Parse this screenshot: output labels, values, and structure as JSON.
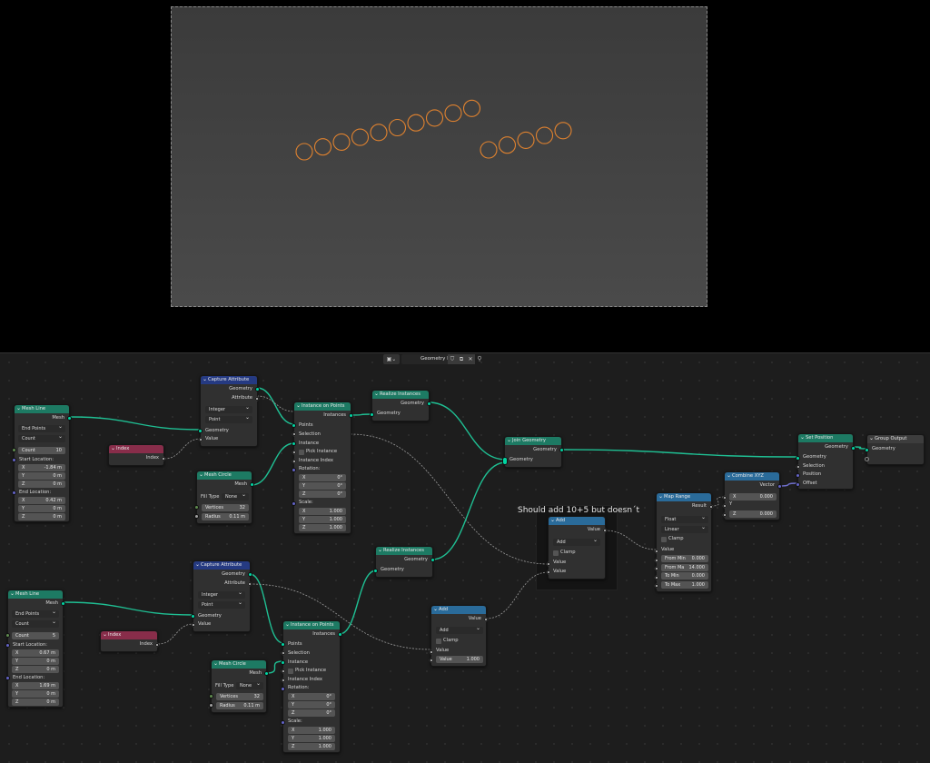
{
  "header": {
    "editor_name": "Geometry Nodes",
    "icon": "node-tree-icon",
    "btn_icons": [
      "shield-icon",
      "copy-icon",
      "close-icon"
    ],
    "pin_icon": "pin-icon"
  },
  "frame_note": "Should add 10+5 but doesn´t",
  "viewport": {
    "row1_circles": 10,
    "row2_circles": 5,
    "circle_color": "#e0822f"
  },
  "nodes": {
    "mesh_line_1": {
      "title": "Mesh Line",
      "out": "Mesh",
      "mode": "End Points",
      "count_mode": "Count",
      "count_k": "Count",
      "count_v": "10",
      "start": "Start Location:",
      "sx": "-1.84 m",
      "sy": "0 m",
      "sz": "0 m",
      "end": "End Location:",
      "ex": "0.42 m",
      "ey": "0 m",
      "ez": "0 m"
    },
    "mesh_line_2": {
      "title": "Mesh Line",
      "out": "Mesh",
      "mode": "End Points",
      "count_mode": "Count",
      "count_k": "Count",
      "count_v": "5",
      "start": "Start Location:",
      "sx": "0.67 m",
      "sy": "0 m",
      "sz": "0 m",
      "end": "End Location:",
      "ex": "1.69 m",
      "ey": "0 m",
      "ez": "0 m"
    },
    "index_1": {
      "title": "Index",
      "out": "Index"
    },
    "index_2": {
      "title": "Index",
      "out": "Index"
    },
    "capture_1": {
      "title": "Capture Attribute",
      "out1": "Geometry",
      "out2": "Attribute",
      "type": "Integer",
      "domain": "Point",
      "in1": "Geometry",
      "in2": "Value"
    },
    "capture_2": {
      "title": "Capture Attribute",
      "out1": "Geometry",
      "out2": "Attribute",
      "type": "Integer",
      "domain": "Point",
      "in1": "Geometry",
      "in2": "Value"
    },
    "circle_1": {
      "title": "Mesh Circle",
      "out": "Mesh",
      "fill_label": "Fill Type",
      "fill": "None",
      "vk": "Vertices",
      "vv": "32",
      "rk": "Radius",
      "rv": "0.11 m"
    },
    "circle_2": {
      "title": "Mesh Circle",
      "out": "Mesh",
      "fill_label": "Fill Type",
      "fill": "None",
      "vk": "Vertices",
      "vv": "32",
      "rk": "Radius",
      "rv": "0.11 m"
    },
    "iop_1": {
      "title": "Instance on Points",
      "out": "Instances",
      "points": "Points",
      "selection": "Selection",
      "instance": "Instance",
      "pick": "Pick Instance",
      "idx": "Instance Index",
      "rot": "Rotation:",
      "rx": "0°",
      "ry": "0°",
      "rz": "0°",
      "scale": "Scale:",
      "scx": "1.000",
      "scy": "1.000",
      "scz": "1.000"
    },
    "iop_2": {
      "title": "Instance on Points",
      "out": "Instances",
      "points": "Points",
      "selection": "Selection",
      "instance": "Instance",
      "pick": "Pick Instance",
      "idx": "Instance Index",
      "rot": "Rotation:",
      "rx": "0°",
      "ry": "0°",
      "rz": "0°",
      "scale": "Scale:",
      "scx": "1.000",
      "scy": "1.000",
      "scz": "1.000"
    },
    "realize_1": {
      "title": "Realize Instances",
      "out": "Geometry",
      "in": "Geometry"
    },
    "realize_2": {
      "title": "Realize Instances",
      "out": "Geometry",
      "in": "Geometry"
    },
    "join": {
      "title": "Join Geometry",
      "out": "Geometry",
      "in": "Geometry"
    },
    "add_frame": {
      "title": "Add",
      "out": "Value",
      "op": "Add",
      "clamp": "Clamp",
      "in1": "Value",
      "in2": "Value"
    },
    "add_2": {
      "title": "Add",
      "out": "Value",
      "op": "Add",
      "clamp": "Clamp",
      "in1": "Value",
      "vk": "Value",
      "vv": "1.000"
    },
    "map_range": {
      "title": "Map Range",
      "out": "Result",
      "dtype": "Float",
      "interp": "Linear",
      "clamp": "Clamp",
      "value": "Value",
      "fmin_k": "From Min",
      "fmin_v": "0.000",
      "fmax_k": "From Ma",
      "fmax_v": "14.000",
      "tmin_k": "To Min",
      "tmin_v": "0.000",
      "tmax_k": "To Max",
      "tmax_v": "1.000"
    },
    "combine": {
      "title": "Combine XYZ",
      "out": "Vector",
      "xk": "X",
      "xv": "0.000",
      "y": "Y",
      "zk": "Z",
      "zv": "0.000"
    },
    "set_pos": {
      "title": "Set Position",
      "out": "Geometry",
      "in1": "Geometry",
      "in2": "Selection",
      "in3": "Position",
      "in4": "Offset"
    },
    "group_out": {
      "title": "Group Output",
      "in": "Geometry"
    }
  }
}
